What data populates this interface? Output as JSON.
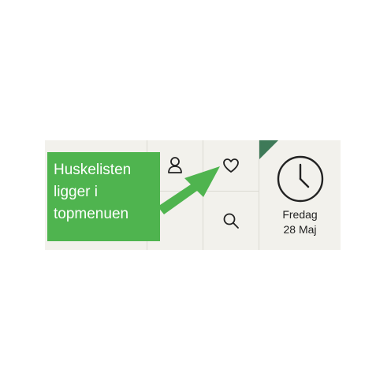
{
  "topmenu": {
    "date": {
      "weekday": "Fredag",
      "day_month": "28 Maj"
    }
  },
  "callout": {
    "lines": [
      "Huskelisten",
      "ligger i",
      "topmenuen"
    ]
  },
  "colors": {
    "panel_background": "#f2f1ec",
    "callout_green": "#4fb44f",
    "corner_tab_green": "#3e7a58"
  }
}
